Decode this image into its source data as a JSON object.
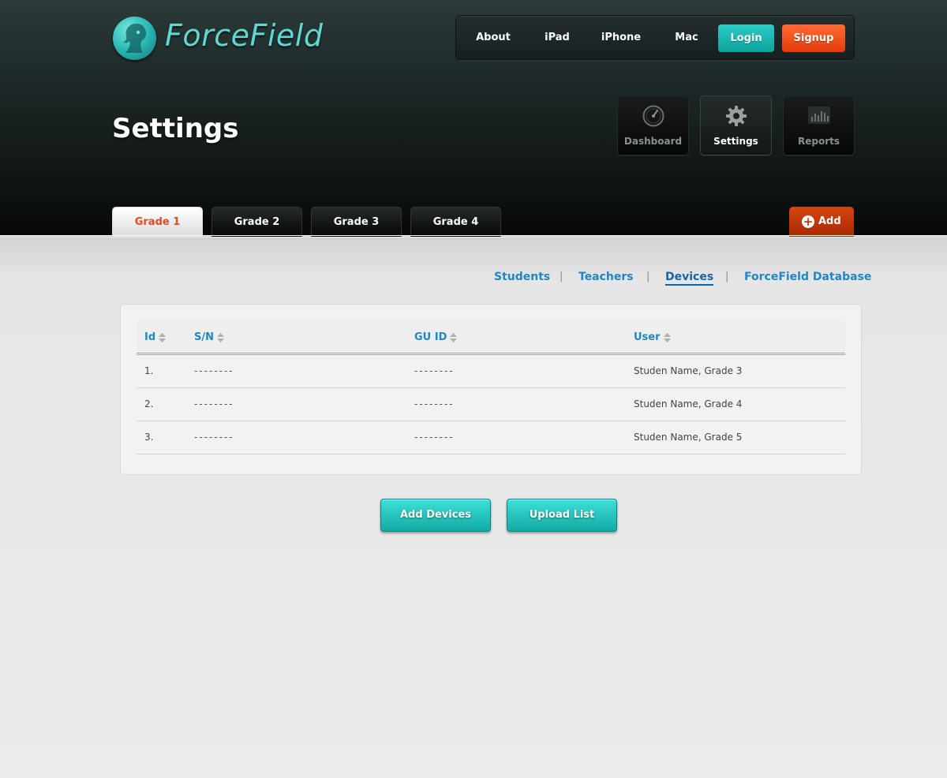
{
  "brand": {
    "name": "ForceField"
  },
  "topnav": {
    "links": [
      "About",
      "iPad",
      "iPhone",
      "Mac"
    ],
    "login_label": "Login",
    "signup_label": "Signup"
  },
  "page": {
    "title": "Settings"
  },
  "tiles": [
    {
      "label": "Dashboard",
      "icon": "gauge-icon",
      "active": false
    },
    {
      "label": "Settings",
      "icon": "gear-icon",
      "active": true
    },
    {
      "label": "Reports",
      "icon": "bar-chart-icon",
      "active": false
    }
  ],
  "grade_tabs": [
    "Grade 1",
    "Grade 2",
    "Grade 3",
    "Grade 4"
  ],
  "active_grade": "Grade 1",
  "add_button": {
    "label": "Add",
    "icon": "plus-circle-icon"
  },
  "subnav": {
    "items": [
      "Students",
      "Teachers",
      "Devices",
      "ForceField Database"
    ],
    "separator": "|",
    "active": "Devices"
  },
  "table": {
    "columns": [
      "Id",
      "S/N",
      "GU ID",
      "User"
    ],
    "sort_icon": "sort-arrows-icon",
    "rows": [
      {
        "id": "1.",
        "sn": "--------",
        "guid": "--------",
        "user": "Studen Name, Grade 3"
      },
      {
        "id": "2.",
        "sn": "--------",
        "guid": "--------",
        "user": "Studen Name, Grade 4"
      },
      {
        "id": "3.",
        "sn": "--------",
        "guid": "--------",
        "user": "Studen Name, Grade 5"
      }
    ]
  },
  "actions": {
    "add_devices_label": "Add Devices",
    "upload_list_label": "Upload List"
  },
  "colors": {
    "accent_teal": "#1fb8b3",
    "accent_orange": "#e8491d",
    "link_blue": "#1f86c8"
  }
}
